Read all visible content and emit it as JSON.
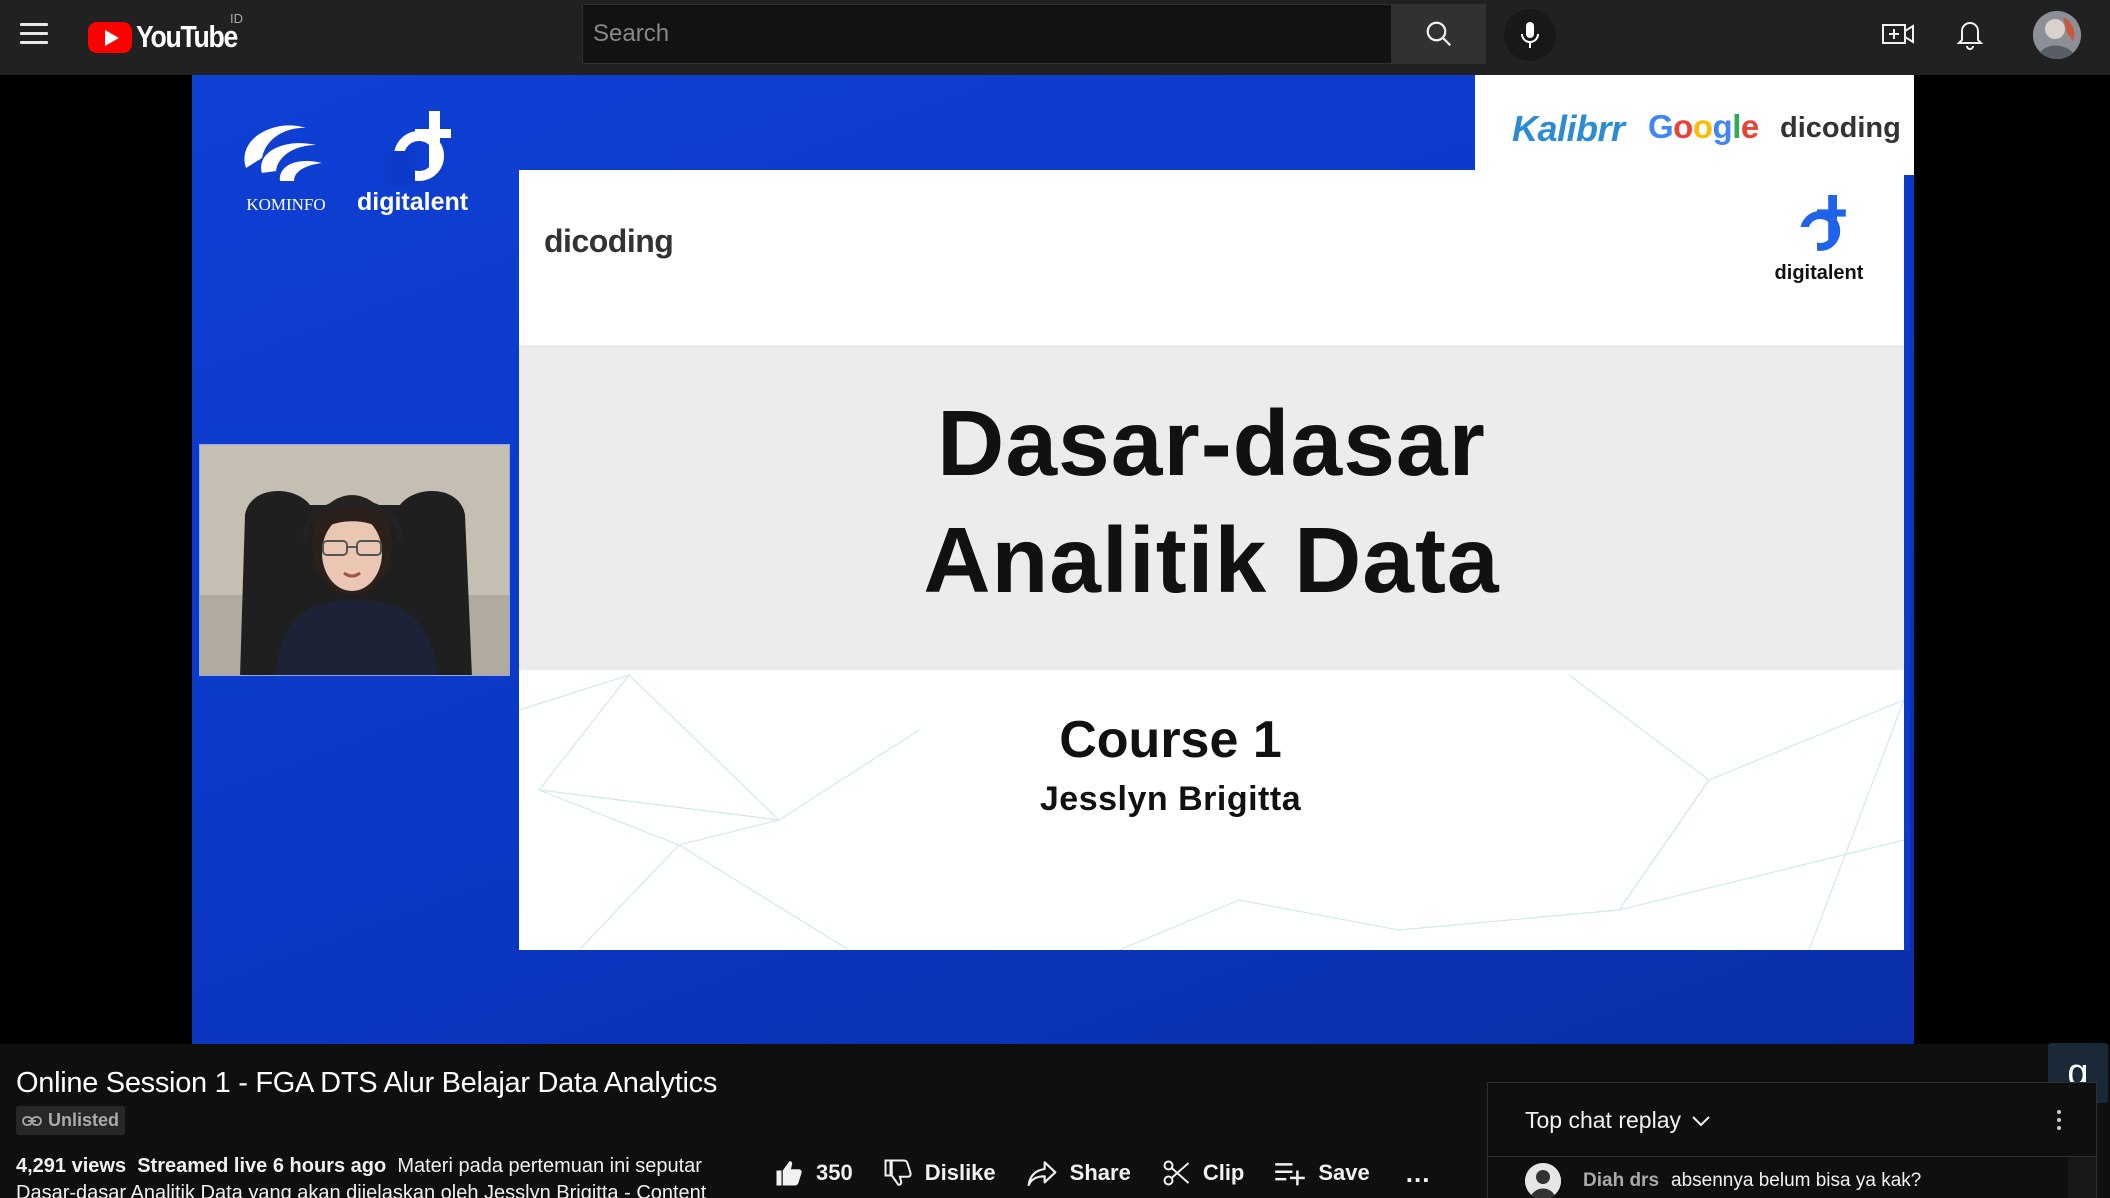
{
  "header": {
    "logo_text": "YouTube",
    "country_code": "ID",
    "search_placeholder": "Search"
  },
  "video": {
    "slide": {
      "title_line1": "Dasar-dasar",
      "title_line2": "Analitik Data",
      "course": "Course 1",
      "presenter": "Jesslyn Brigitta",
      "logo_dicoding": "dicoding",
      "logo_digitalent": "digitalent"
    },
    "frame_logos": {
      "kominfo": "KOMINFO",
      "digitalent": "digitalent",
      "kalibrr": "Kalibrr",
      "google": [
        "G",
        "o",
        "o",
        "g",
        "l",
        "e"
      ],
      "dicoding": "dicoding"
    },
    "corner_badge": "g"
  },
  "info": {
    "title": "Online Session 1 - FGA DTS Alur Belajar Data Analytics",
    "visibility": "Unlisted",
    "views": "4,291 views",
    "streamed": "Streamed live 6 hours ago",
    "description_line1": "Materi pada pertemuan ini seputar",
    "description_line2": "Dasar-dasar Analitik Data yang akan dijelaskan oleh Jesslyn Brigitta - Content"
  },
  "actions": {
    "like_count": "350",
    "dislike": "Dislike",
    "share": "Share",
    "clip": "Clip",
    "save": "Save",
    "more": "..."
  },
  "chat": {
    "title": "Top chat replay",
    "messages": [
      {
        "author": "Diah drs",
        "text": "absennya belum bisa ya kak?"
      }
    ]
  },
  "colors": {
    "brand_red": "#ff0000",
    "frame_blue": "#0b37c4",
    "background": "#0f0f0f"
  }
}
